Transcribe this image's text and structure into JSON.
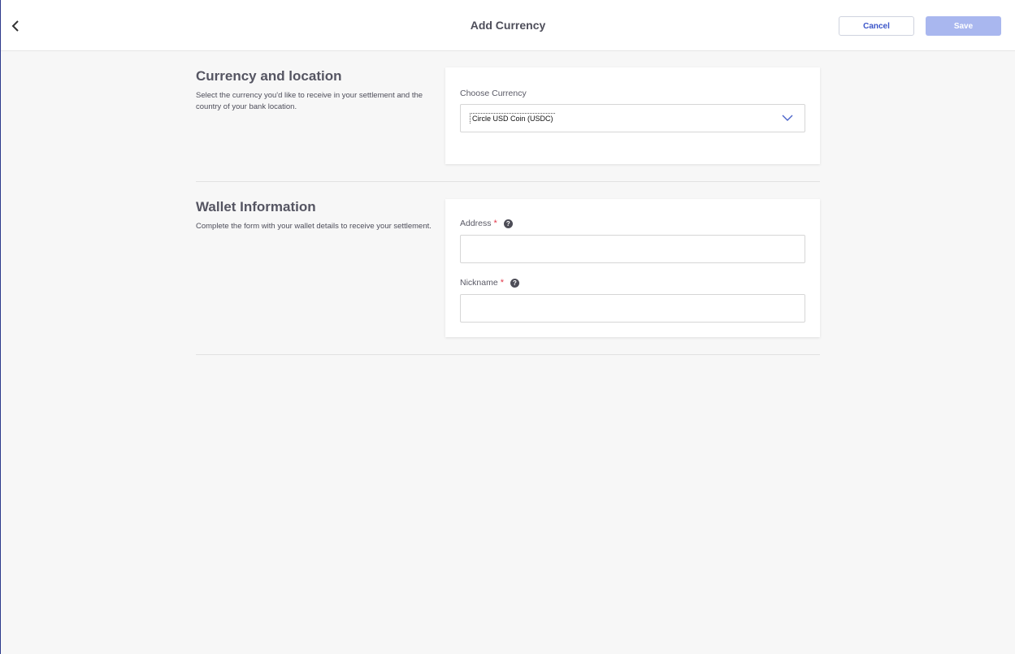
{
  "header": {
    "title": "Add Currency",
    "cancel_label": "Cancel",
    "save_label": "Save",
    "back_icon": "chevron-left-icon"
  },
  "currency_section": {
    "title": "Currency and location",
    "description": "Select the currency you'd like to receive in your settlement and the country of your bank location.",
    "choose_currency_label": "Choose Currency",
    "selected_currency": "Circle USD Coin (USDC)",
    "dropdown_icon": "chevron-down-icon"
  },
  "wallet_section": {
    "title": "Wallet Information",
    "description": "Complete the form with your wallet details to receive your settlement.",
    "address_label": "Address",
    "address_value": "",
    "nickname_label": "Nickname",
    "nickname_value": "",
    "required_marker": "*",
    "help_icon": "question-circle-icon",
    "help_glyph": "?"
  },
  "colors": {
    "accent": "#3b55c9",
    "save_disabled": "#a9b7ef",
    "required": "#e2394b",
    "background": "#f7f7f7"
  }
}
